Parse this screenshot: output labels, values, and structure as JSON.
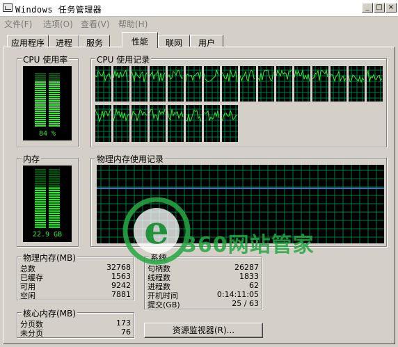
{
  "window": {
    "title": "Windows 任务管理器"
  },
  "menu": [
    {
      "label": "文件(F)"
    },
    {
      "label": "选项(O)"
    },
    {
      "label": "查看(V)"
    },
    {
      "label": "帮助(H)"
    }
  ],
  "tabs": [
    {
      "label": "应用程序",
      "active": false
    },
    {
      "label": "进程",
      "active": false
    },
    {
      "label": "服务",
      "active": false
    },
    {
      "label": "性能",
      "active": true
    },
    {
      "label": "联网",
      "active": false
    },
    {
      "label": "用户",
      "active": false
    }
  ],
  "cpu_usage": {
    "title": "CPU 使用率",
    "percent_label": "84 %",
    "level": 0.84
  },
  "cpu_history": {
    "title": "CPU 使用记录",
    "cores": 24
  },
  "memory": {
    "title": "内存",
    "value_label": "22.9 GB",
    "level": 0.7
  },
  "memory_history": {
    "title": "物理内存使用记录",
    "level": 0.7
  },
  "physical_memory": {
    "title": "物理内存(MB)",
    "rows": [
      {
        "label": "总数",
        "value": "32768"
      },
      {
        "label": "已缓存",
        "value": "1563"
      },
      {
        "label": "可用",
        "value": "9242"
      },
      {
        "label": "空闲",
        "value": "7881"
      }
    ]
  },
  "system": {
    "title": "系统",
    "rows": [
      {
        "label": "句柄数",
        "value": "26287"
      },
      {
        "label": "线程数",
        "value": "1833"
      },
      {
        "label": "进程数",
        "value": "62"
      },
      {
        "label": "开机时间",
        "value": "0:14:11:05"
      },
      {
        "label": "提交(GB)",
        "value": "25 / 63"
      }
    ]
  },
  "kernel_memory": {
    "title": "核心内存(MB)",
    "rows": [
      {
        "label": "分页数",
        "value": "173"
      },
      {
        "label": "未分页",
        "value": "76"
      }
    ]
  },
  "resource_monitor_button": {
    "label": "资源监视器(R)..."
  },
  "watermark": {
    "text": "360网站管家",
    "letter": "e"
  },
  "colors": {
    "graph_green": "#36e636",
    "grid_green": "#008040",
    "memory_line": "#5070c8",
    "meter_off": "#0a5a12"
  }
}
